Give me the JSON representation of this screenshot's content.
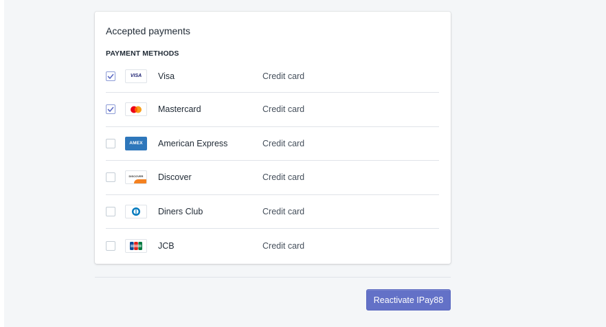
{
  "card": {
    "title": "Accepted payments",
    "section_label": "PAYMENT METHODS"
  },
  "methods": [
    {
      "name": "Visa",
      "type": "Credit card",
      "checked": true,
      "logo": "visa-logo",
      "logo_text": "VISA"
    },
    {
      "name": "Mastercard",
      "type": "Credit card",
      "checked": true,
      "logo": "mastercard-logo"
    },
    {
      "name": "American Express",
      "type": "Credit card",
      "checked": false,
      "logo": "amex-logo",
      "logo_text": "AMEX"
    },
    {
      "name": "Discover",
      "type": "Credit card",
      "checked": false,
      "logo": "discover-logo",
      "logo_text": "DISCOVER"
    },
    {
      "name": "Diners Club",
      "type": "Credit card",
      "checked": false,
      "logo": "diners-club-logo"
    },
    {
      "name": "JCB",
      "type": "Credit card",
      "checked": false,
      "logo": "jcb-logo"
    }
  ],
  "footer": {
    "button_label": "Reactivate IPay88"
  },
  "colors": {
    "page_bg": "#f4f6f8",
    "card_bg": "#ffffff",
    "button_bg": "#6371c7",
    "check_color": "#5c6ac4",
    "divider": "#dfe3e8"
  }
}
